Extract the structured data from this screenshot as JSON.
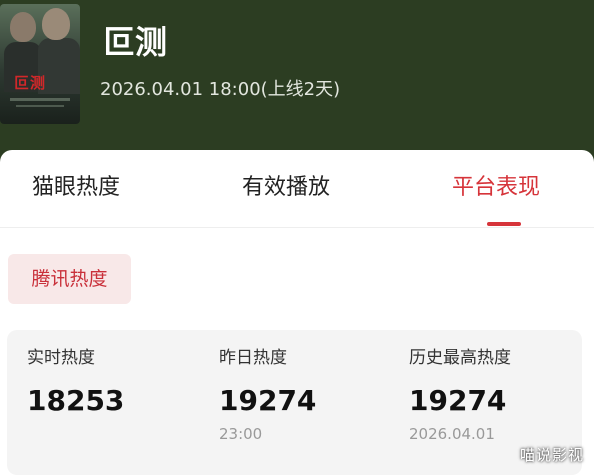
{
  "header": {
    "poster_title": "叵测",
    "title": "叵测",
    "subtitle": "2026.04.01 18:00(上线2天)"
  },
  "tabs": [
    {
      "label": "猫眼热度",
      "active": false
    },
    {
      "label": "有效播放",
      "active": false
    },
    {
      "label": "平台表现",
      "active": true
    }
  ],
  "chip": {
    "label": "腾讯热度"
  },
  "metrics": [
    {
      "label": "实时热度",
      "value": "18253",
      "sub": ""
    },
    {
      "label": "昨日热度",
      "value": "19274",
      "sub": "23:00"
    },
    {
      "label": "历史最高热度",
      "value": "19274",
      "sub": "2026.04.01"
    }
  ],
  "watermark": "喵说影视",
  "colors": {
    "header_bg": "#2c3d22",
    "accent": "#d6343a",
    "chip_bg": "#f8e8e8",
    "card_bg": "#f4f4f4"
  }
}
